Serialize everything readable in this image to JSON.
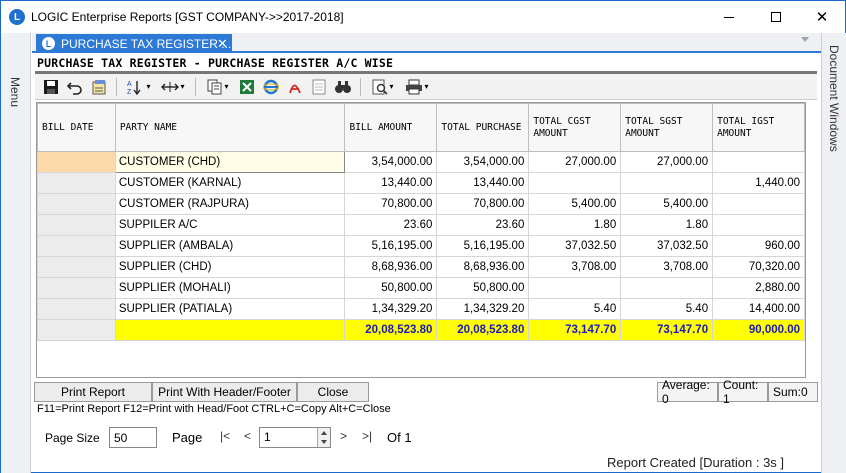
{
  "window": {
    "title": "LOGIC Enterprise Reports  [GST COMPANY->>2017-2018]",
    "logo_letter": "L",
    "minimize_icon": "minimize-icon",
    "maximize_icon": "maximize-icon",
    "close_glyph": "✕"
  },
  "side": {
    "menu_label": "Menu",
    "doc_windows_label": "Document Windows"
  },
  "tab": {
    "label": "PURCHASE TAX REGISTER ...",
    "close_glyph": "✕"
  },
  "report": {
    "title": "PURCHASE TAX REGISTER - PURCHASE REGISTER A/C WISE"
  },
  "toolbar": {
    "icons": [
      "save-icon",
      "undo-icon",
      "page-setup-icon",
      "sort-icon",
      "column-width-icon",
      "copy-icon",
      "excel-icon",
      "ie-icon",
      "pdf-icon",
      "document-icon",
      "find-icon",
      "preview-icon",
      "print-icon"
    ]
  },
  "grid": {
    "columns": [
      "BILL DATE",
      "PARTY NAME",
      "BILL AMOUNT",
      "TOTAL PURCHASE",
      "TOTAL CGST AMOUNT",
      "TOTAL SGST AMOUNT",
      "TOTAL IGST AMOUNT"
    ],
    "rows": [
      [
        "",
        "CUSTOMER (CHD)",
        "3,54,000.00",
        "3,54,000.00",
        "27,000.00",
        "27,000.00",
        ""
      ],
      [
        "",
        "CUSTOMER (KARNAL)",
        "13,440.00",
        "13,440.00",
        "",
        "",
        "1,440.00"
      ],
      [
        "",
        "CUSTOMER (RAJPURA)",
        "70,800.00",
        "70,800.00",
        "5,400.00",
        "5,400.00",
        ""
      ],
      [
        "",
        "SUPPILER A/C",
        "23.60",
        "23.60",
        "1.80",
        "1.80",
        ""
      ],
      [
        "",
        "SUPPLIER (AMBALA)",
        "5,16,195.00",
        "5,16,195.00",
        "37,032.50",
        "37,032.50",
        "960.00"
      ],
      [
        "",
        "SUPPLIER (CHD)",
        "8,68,936.00",
        "8,68,936.00",
        "3,708.00",
        "3,708.00",
        "70,320.00"
      ],
      [
        "",
        "SUPPLIER (MOHALI)",
        "50,800.00",
        "50,800.00",
        "",
        "",
        "2,880.00"
      ],
      [
        "",
        "SUPPLIER (PATIALA)",
        "1,34,329.20",
        "1,34,329.20",
        "5.40",
        "5.40",
        "14,400.00"
      ]
    ],
    "totals": [
      "",
      "",
      "20,08,523.80",
      "20,08,523.80",
      "73,147.70",
      "73,147.70",
      "90,000.00"
    ]
  },
  "buttons": {
    "print_report": "Print Report",
    "print_header_footer": "Print With Header/Footer",
    "close": "Close"
  },
  "stats": {
    "average": "Average: 0",
    "count": "Count: 1",
    "sum": "Sum:0"
  },
  "hint": "F11=Print Report  F12=Print with Head/Foot  CTRL+C=Copy  Alt+C=Close",
  "pager": {
    "page_size_label": "Page Size",
    "page_size_value": "50",
    "page_label": "Page",
    "first": "|<",
    "prev": "<",
    "page_value": "1",
    "next": ">",
    "last": ">|",
    "of_label": "Of 1"
  },
  "status": "Report Created [Duration : 3s ]"
}
